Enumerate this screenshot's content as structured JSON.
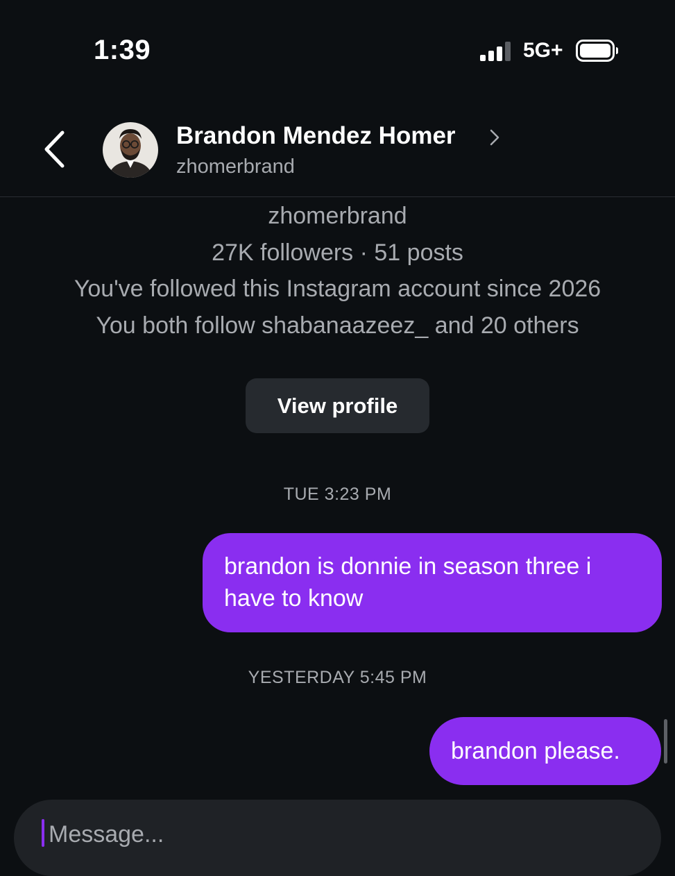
{
  "status_bar": {
    "time": "1:39",
    "network": "5G+",
    "signal_icon": "cellular-signal-icon",
    "battery_icon": "battery-icon"
  },
  "header": {
    "back_icon": "chevron-left-icon",
    "name": "Brandon Mendez Homer",
    "chevron_icon": "chevron-right-icon",
    "username": "zhomerbrand"
  },
  "profile_card": {
    "username": "zhomerbrand",
    "stats": "27K followers · 51 posts",
    "followed_since": "You've followed this Instagram account since 2026",
    "mutual": "You both follow shabanaazeez_ and 20 others",
    "view_profile_label": "View profile"
  },
  "thread": {
    "groups": [
      {
        "timestamp": "TUE 3:23 PM",
        "messages": [
          {
            "text": "brandon is donnie in season three i have to know",
            "sender": "me"
          }
        ]
      },
      {
        "timestamp": "YESTERDAY 5:45 PM",
        "messages": [
          {
            "text": "brandon please.",
            "sender": "me"
          }
        ]
      }
    ]
  },
  "composer": {
    "placeholder": "Message..."
  },
  "colors": {
    "background": "#0c0f12",
    "outgoing_bubble": "#8a2ef0",
    "secondary_text": "#a8abb0",
    "button_bg": "#262a2f",
    "composer_bg": "#1f2226"
  }
}
